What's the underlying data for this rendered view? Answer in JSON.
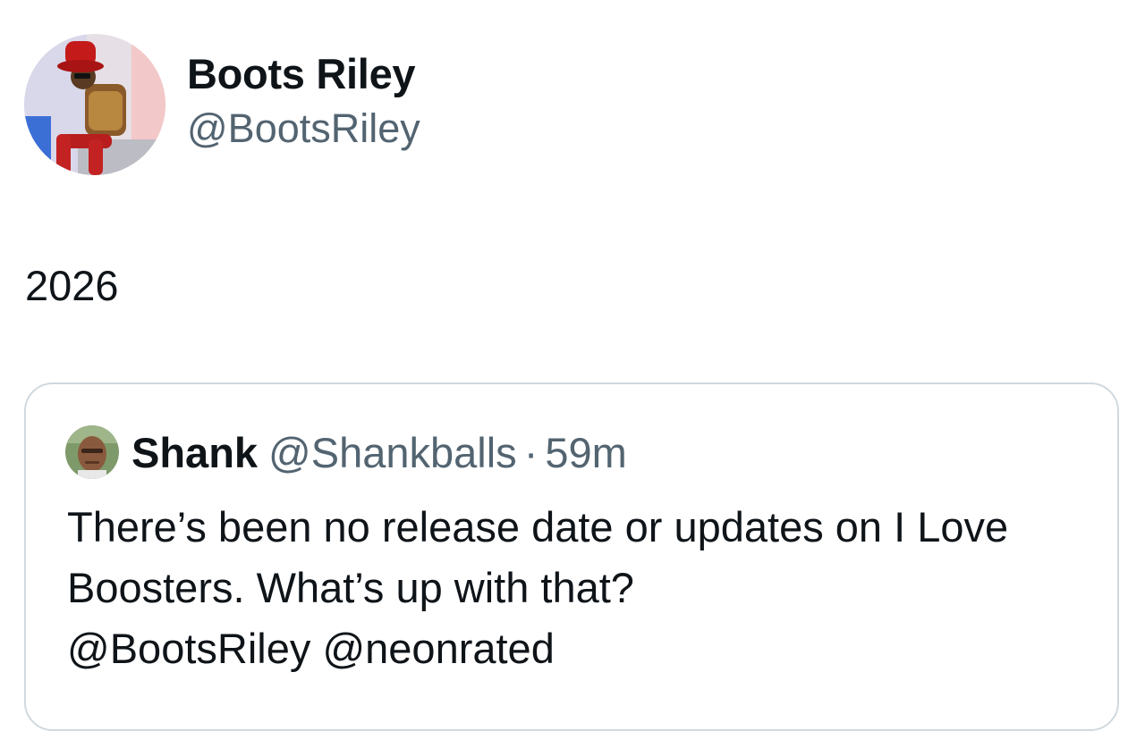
{
  "author": {
    "display_name": "Boots Riley",
    "handle": "@BootsRiley"
  },
  "tweet": {
    "text": "2026"
  },
  "quoted_tweet": {
    "display_name": "Shank",
    "handle": "@Shankballs",
    "separator": "·",
    "time": "59m",
    "text_parts": [
      "There’s been no release date or updates on I Love Boosters. What’s up with that?",
      "@BootsRiley",
      "@neonrated"
    ]
  },
  "colors": {
    "primary_text": "#0f1419",
    "secondary_text": "#536471",
    "border": "#cfd9de"
  }
}
